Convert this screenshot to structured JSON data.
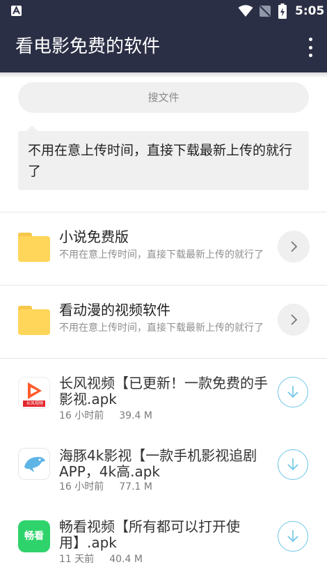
{
  "status_bar": {
    "time": "5:05",
    "left_icon": "a-notification-icon",
    "icons": [
      "wifi-icon",
      "no-sim-icon",
      "battery-charging-icon"
    ]
  },
  "app_bar": {
    "title": "看电影免费的软件",
    "menu_icon": "more-vert-icon"
  },
  "search": {
    "placeholder": "搜文件"
  },
  "message": {
    "text": "不用在意上传时间，直接下载最新上传的就行了"
  },
  "folders": [
    {
      "name": "小说免费版",
      "description": "不用在意上传时间，直接下载最新上传的就行了",
      "icon": "folder-icon"
    },
    {
      "name": "看动漫的视频软件",
      "description": "不用在意上传时间，直接下载最新上传的就行了",
      "icon": "folder-icon"
    }
  ],
  "files": [
    {
      "name": "长风视频【已更新！一款免费的手影视.apk",
      "time": "16 小时前",
      "size": "39.4 M",
      "icon": "changfeng-app-icon",
      "icon_text": "长风视频"
    },
    {
      "name": "海豚4k影视【一款手机影视追剧APP，4k高.apk",
      "time": "16 小时前",
      "size": "77.1 M",
      "icon": "dolphin-app-icon"
    },
    {
      "name": "畅看视频【所有都可以打开使用】.apk",
      "time": "11 天前",
      "size": "40.4 M",
      "icon": "changkan-app-icon",
      "icon_text": "畅看"
    }
  ],
  "colors": {
    "app_bar": "#2b2f45",
    "accent_download": "#6cc6e8",
    "folder": "#ffd65a",
    "changkan_green": "#2fd36b"
  }
}
